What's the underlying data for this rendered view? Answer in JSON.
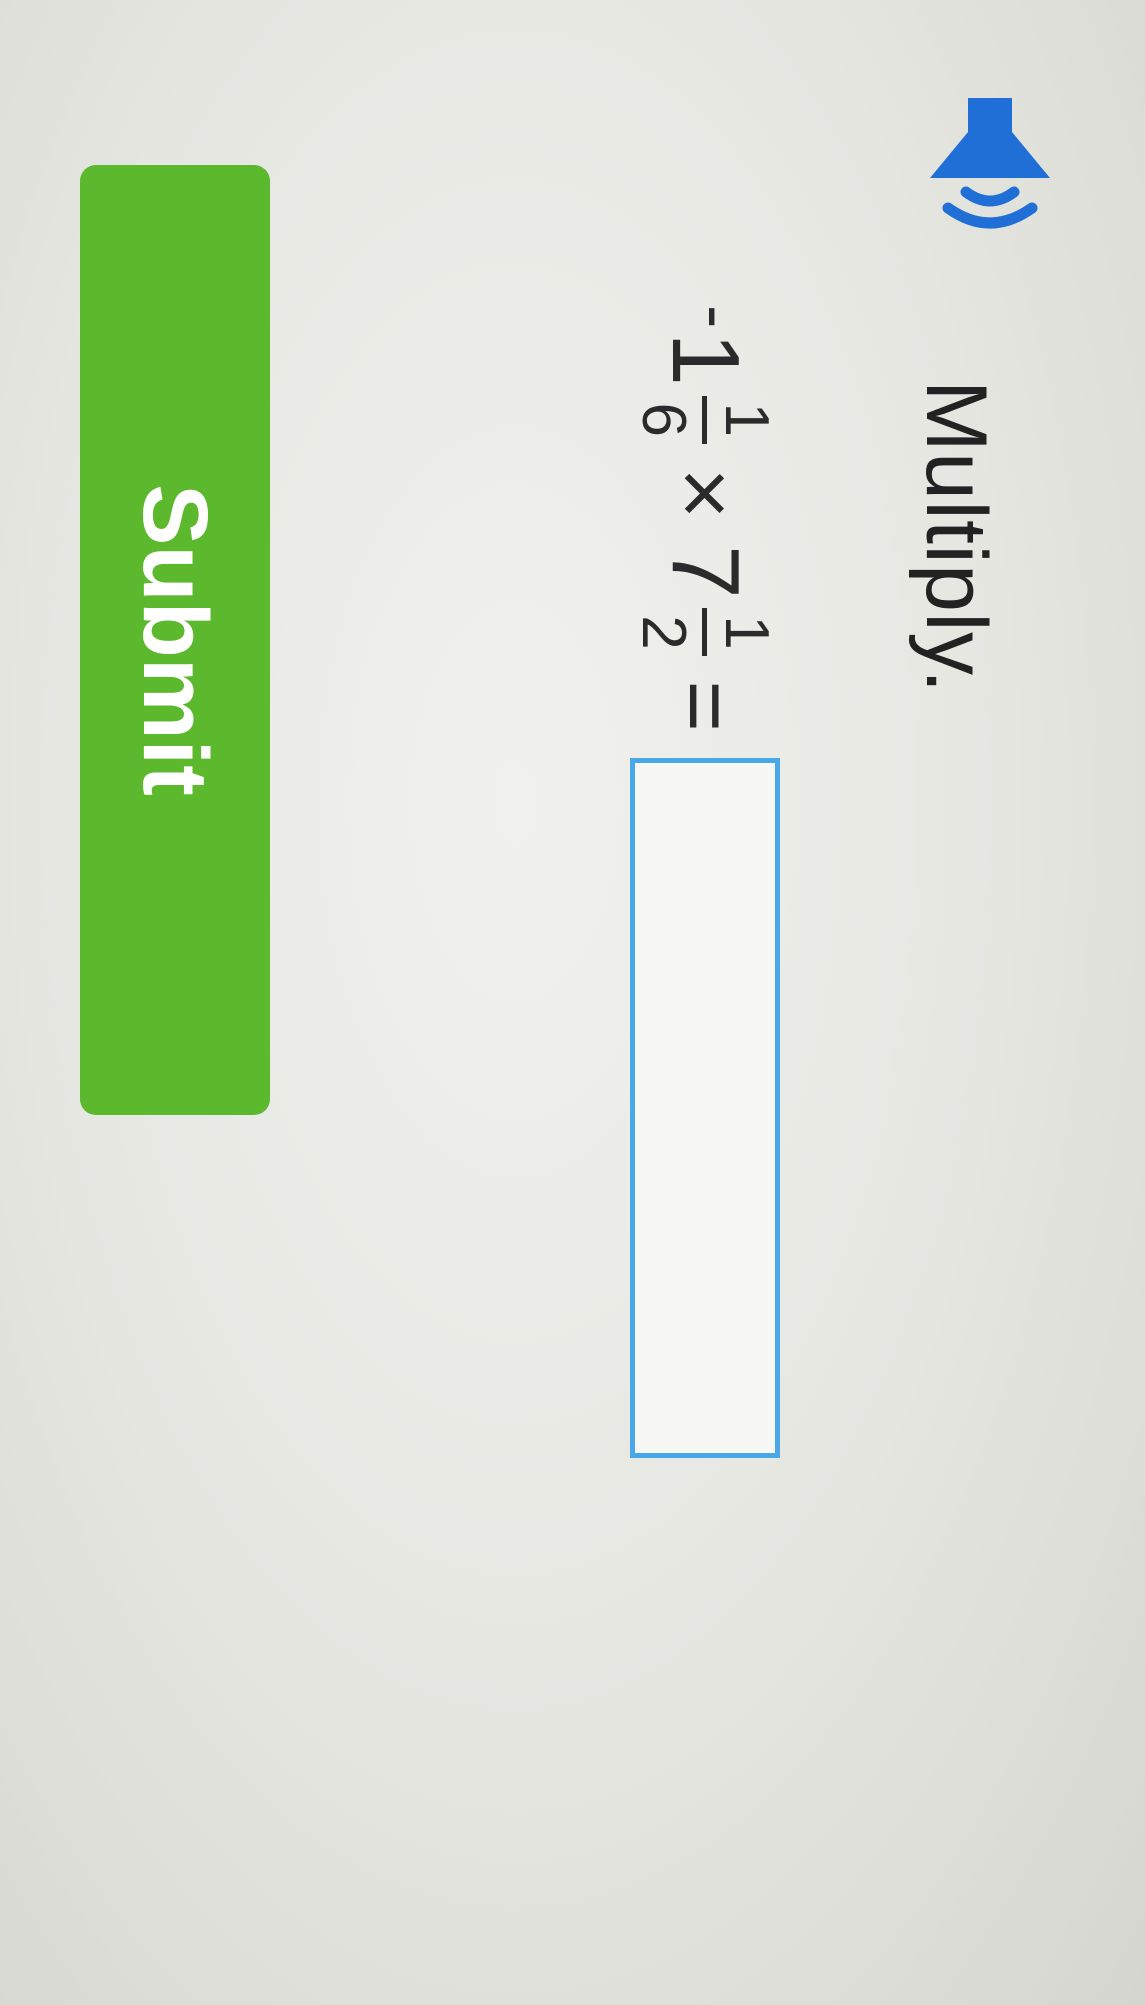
{
  "prompt": {
    "title": "Multiply."
  },
  "icons": {
    "audio": "speaker-icon"
  },
  "problem": {
    "sign": "-",
    "first": {
      "whole": "1",
      "numerator": "1",
      "denominator": "6"
    },
    "operator": "×",
    "second": {
      "whole": "7",
      "numerator": "1",
      "denominator": "2"
    },
    "equals": "=",
    "answer": {
      "value": "",
      "placeholder": ""
    }
  },
  "actions": {
    "submit_label": "Submit"
  },
  "colors": {
    "speaker": "#1f6fd6",
    "answer_border": "#4aa8e8",
    "submit_background": "#5cb82c",
    "submit_text": "#ffffff"
  }
}
